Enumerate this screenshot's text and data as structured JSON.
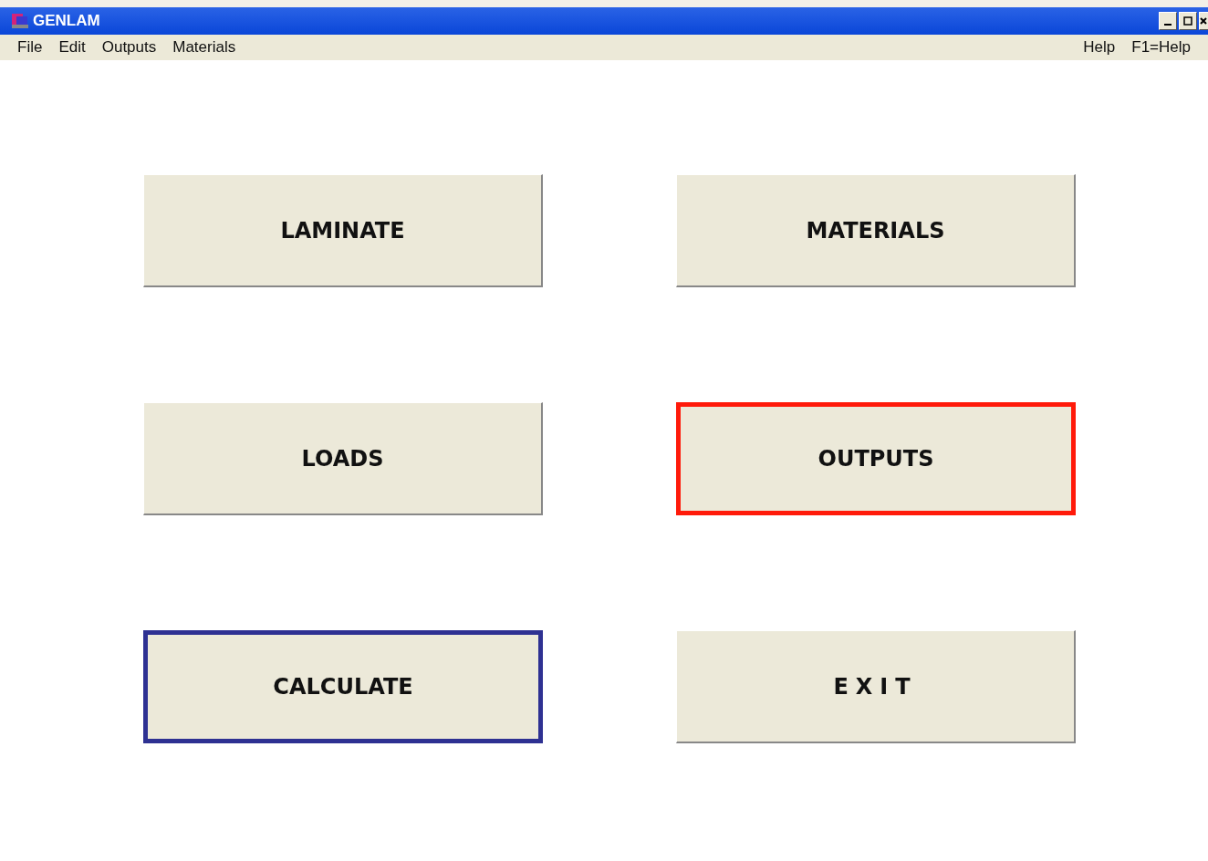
{
  "window": {
    "title": "GENLAM"
  },
  "menu": {
    "left": [
      "File",
      "Edit",
      "Outputs",
      "Materials"
    ],
    "right": [
      "Help",
      "F1=Help"
    ]
  },
  "buttons": [
    {
      "label": "LAMINATE",
      "spaced": false
    },
    {
      "label": "MATERIALS",
      "spaced": false
    },
    {
      "label": "LOADS",
      "spaced": false
    },
    {
      "label": "OUTPUTS",
      "spaced": false,
      "color": "#ff1a0a"
    },
    {
      "label": "CALCULATE",
      "spaced": false,
      "color": "#2e3192"
    },
    {
      "label": "EXIT",
      "spaced": true
    }
  ]
}
